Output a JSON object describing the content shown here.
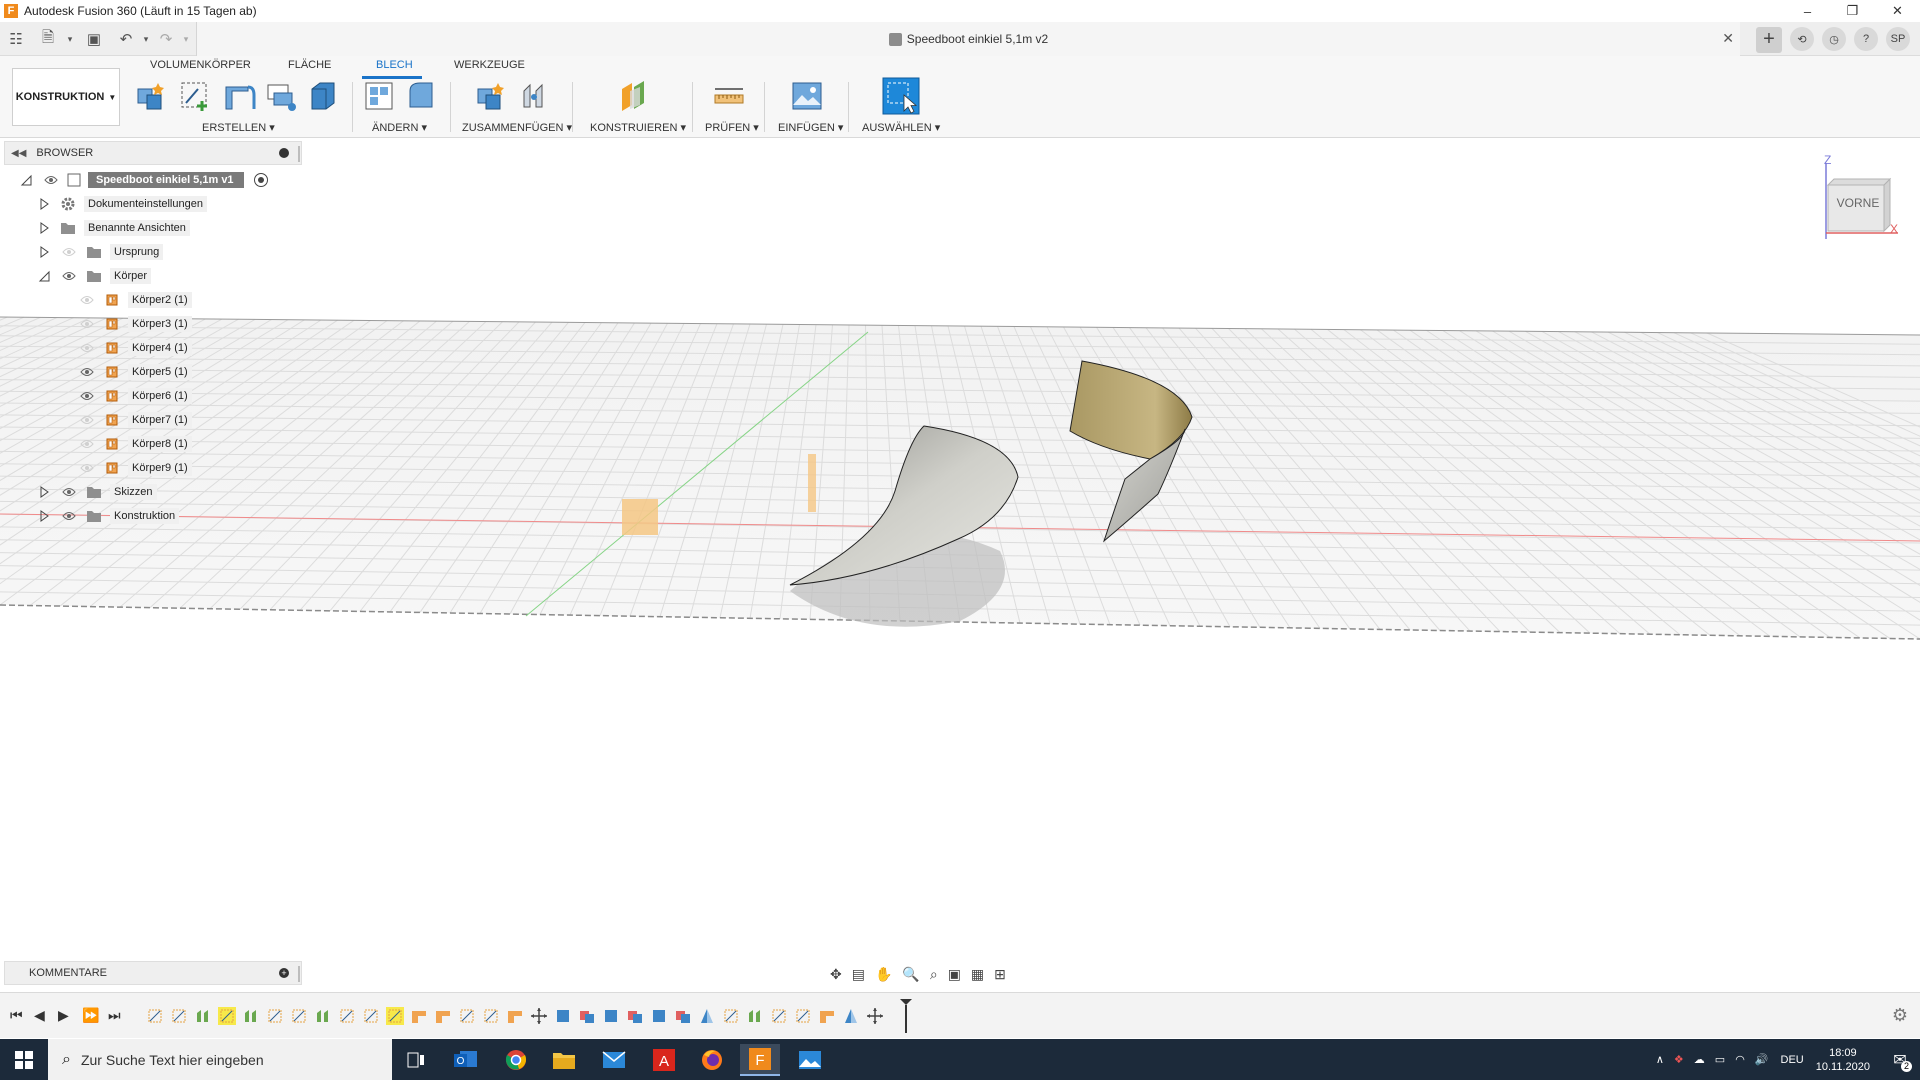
{
  "window": {
    "title": "Autodesk Fusion 360 (Läuft in 15 Tagen ab)",
    "document_title": "Speedboot einkiel 5,1m v2",
    "user_initials": "SP"
  },
  "ribbon": {
    "workspace": "KONSTRUKTION",
    "tabs": [
      {
        "label": "VOLUMENKÖRPER"
      },
      {
        "label": "FLÄCHE"
      },
      {
        "label": "BLECH"
      },
      {
        "label": "WERKZEUGE"
      }
    ],
    "groups": [
      {
        "label": "ERSTELLEN"
      },
      {
        "label": "ÄNDERN"
      },
      {
        "label": "ZUSAMMENFÜGEN"
      },
      {
        "label": "KONSTRUIEREN"
      },
      {
        "label": "PRÜFEN"
      },
      {
        "label": "EINFÜGEN"
      },
      {
        "label": "AUSWÄHLEN"
      }
    ]
  },
  "browser": {
    "title": "BROWSER",
    "root": "Speedboot einkiel 5,1m v1",
    "items": [
      {
        "label": "Dokumenteinstellungen"
      },
      {
        "label": "Benannte Ansichten"
      },
      {
        "label": "Ursprung"
      },
      {
        "label": "Körper"
      },
      {
        "label": "Körper2 (1)"
      },
      {
        "label": "Körper3 (1)"
      },
      {
        "label": "Körper4 (1)"
      },
      {
        "label": "Körper5 (1)"
      },
      {
        "label": "Körper6 (1)"
      },
      {
        "label": "Körper7 (1)"
      },
      {
        "label": "Körper8 (1)"
      },
      {
        "label": "Körper9 (1)"
      },
      {
        "label": "Skizzen"
      },
      {
        "label": "Konstruktion"
      }
    ]
  },
  "comments": {
    "title": "KOMMENTARE"
  },
  "viewcube": {
    "face": "VORNE",
    "axis_z": "Z",
    "axis_x": "X"
  },
  "taskbar": {
    "search_placeholder": "Zur Suche Text hier eingeben",
    "language": "DEU",
    "time": "18:09",
    "date": "10.11.2020",
    "notifications": "2"
  },
  "colors": {
    "accent": "#1a73c8",
    "body_orange": "#f08a1c",
    "surface_gray": "#c9c9c4",
    "surface_tan": "#b9a774",
    "taskbar": "#1c2a3a"
  }
}
